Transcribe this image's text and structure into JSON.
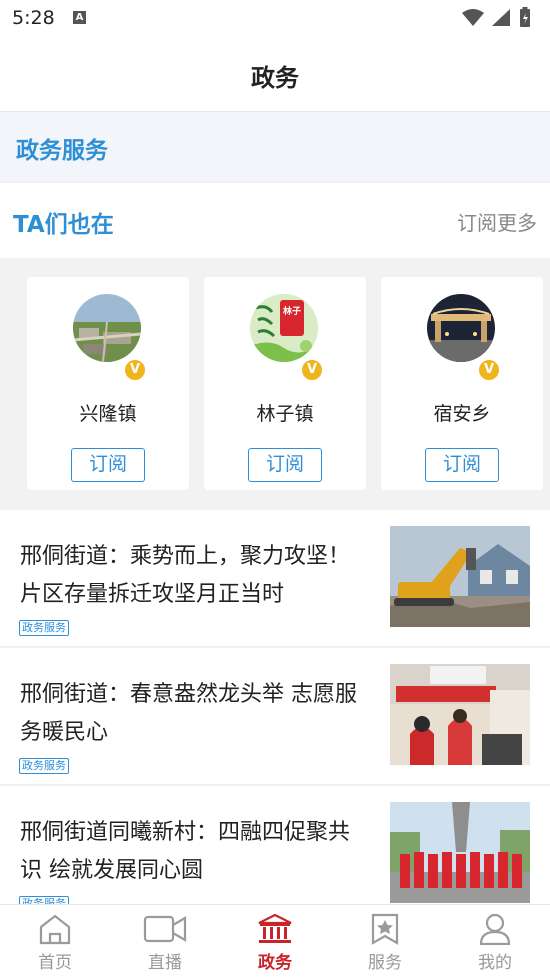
{
  "status_bar": {
    "time": "5:28",
    "notification_icon": "A"
  },
  "header": {
    "title": "政务"
  },
  "service_section": {
    "title": "政务服务"
  },
  "subscribe_section": {
    "title": "TA们也在",
    "more_label": "订阅更多"
  },
  "accounts": [
    {
      "name": "兴隆镇",
      "subscribe_label": "订阅",
      "badge": "V"
    },
    {
      "name": "林子镇",
      "subscribe_label": "订阅",
      "badge": "V",
      "avatar_text": "林子"
    },
    {
      "name": "宿安乡",
      "subscribe_label": "订阅",
      "badge": "V"
    }
  ],
  "news": [
    {
      "title": "邢侗街道：乘势而上，聚力攻坚！片区存量拆迁攻坚月正当时",
      "tag": "政务服务"
    },
    {
      "title": "邢侗街道：春意盎然龙头举  志愿服务暖民心",
      "tag": "政务服务"
    },
    {
      "title": "邢侗街道同曦新村：四融四促聚共识    绘就发展同心圆",
      "tag": "政务服务"
    }
  ],
  "tabs": [
    {
      "label": "首页",
      "icon": "home-icon"
    },
    {
      "label": "直播",
      "icon": "video-icon"
    },
    {
      "label": "政务",
      "icon": "government-icon",
      "active": true
    },
    {
      "label": "服务",
      "icon": "star-card-icon"
    },
    {
      "label": "我的",
      "icon": "user-icon"
    }
  ],
  "colors": {
    "accent": "#2f8fd6",
    "active_tab": "#c8242b",
    "badge": "#f1b51c"
  }
}
